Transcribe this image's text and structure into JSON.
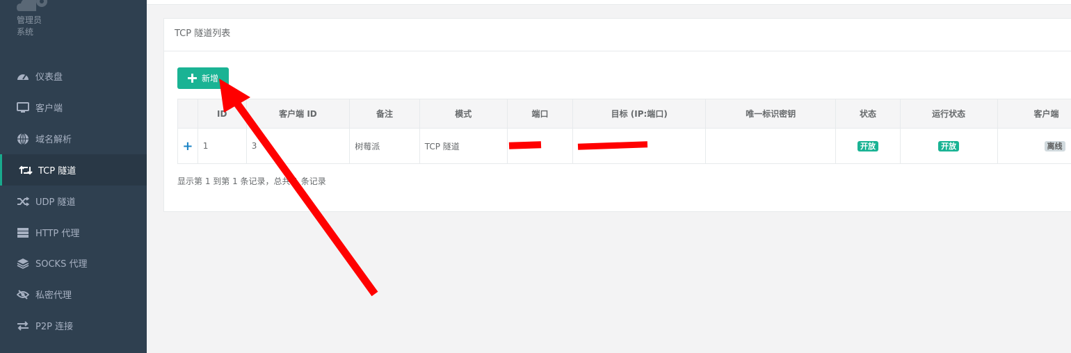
{
  "sidebar": {
    "role": "管理员",
    "role_line2": "系统",
    "items": [
      {
        "label": "仪表盘",
        "icon": "dashboard-icon"
      },
      {
        "label": "客户端",
        "icon": "desktop-icon"
      },
      {
        "label": "域名解析",
        "icon": "globe-icon"
      },
      {
        "label": "TCP 隧道",
        "icon": "retweet-icon",
        "active": true
      },
      {
        "label": "UDP 隧道",
        "icon": "shuffle-icon"
      },
      {
        "label": "HTTP 代理",
        "icon": "server-icon"
      },
      {
        "label": "SOCKS 代理",
        "icon": "layers-icon"
      },
      {
        "label": "私密代理",
        "icon": "eye-slash-icon"
      },
      {
        "label": "P2P 连接",
        "icon": "exchange-icon"
      }
    ]
  },
  "panel": {
    "title": "TCP 隧道列表",
    "add_button": "新增"
  },
  "table": {
    "headers": [
      "ID",
      "客户端 ID",
      "备注",
      "模式",
      "端口",
      "目标 (IP:端口)",
      "唯一标识密钥",
      "状态",
      "运行状态",
      "客户端"
    ],
    "rows": [
      {
        "id": "1",
        "client_id": "3",
        "remark": "树莓派",
        "mode": "TCP 隧道",
        "port": "",
        "target": "",
        "secret": "",
        "status": "开放",
        "run_status": "开放",
        "client_status": "离线"
      }
    ]
  },
  "footer": {
    "record_count": "显示第 1 到第 1 条记录，总共 1 条记录"
  },
  "colors": {
    "sidebar_bg": "#2f4050",
    "accent": "#1ab394",
    "badge_gray": "#d1dade",
    "annotation_arrow": "#ff0000"
  }
}
